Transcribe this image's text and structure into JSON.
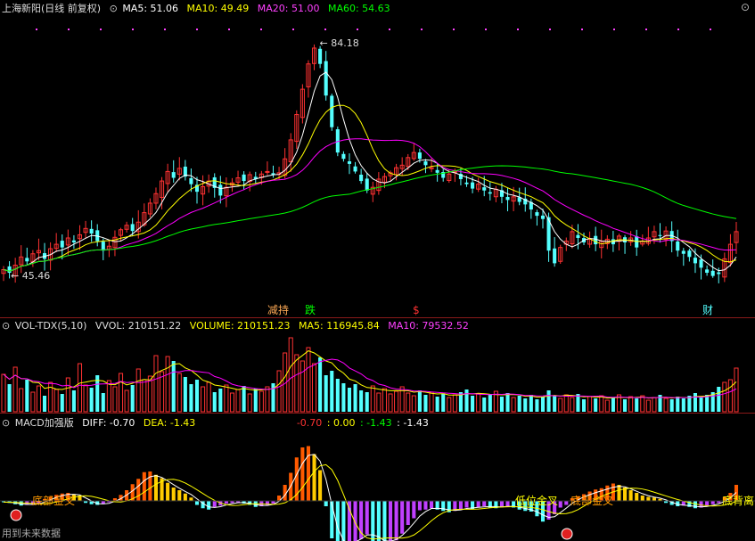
{
  "header": {
    "title": "上海新阳(日线 前复权)",
    "ma5": "MA5: 51.06",
    "ma10": "MA10: 49.49",
    "ma20": "MA20: 51.00",
    "ma60": "MA60: 54.63",
    "corner_icon": "expand-icon"
  },
  "volume_header": {
    "name": "VOL-TDX(5,10)",
    "vvol": "VVOL: 210151.22",
    "volume": "VOLUME: 210151.23",
    "ma5": "MA5: 116945.84",
    "ma10": "MA10: 79532.52"
  },
  "macd_header": {
    "name": "MACD加强版",
    "diff": "DIFF: -0.70",
    "dea": "DEA: -1.43",
    "r1": "-0.70",
    "r2": ": 0.00",
    "r3": ": -1.43",
    "r4": ": -1.43"
  },
  "footer": "用到未来数据",
  "colors": {
    "bg": "#000000",
    "up": "#ff3232",
    "down": "#54ffff",
    "ma5": "#ffffff",
    "ma10": "#ffff00",
    "ma20": "#ff00ff",
    "ma60": "#00ff00",
    "hist_up": "#ff5a00",
    "hist_up2": "#ffcc00",
    "hist_dn": "#54ffff",
    "hist_dn2": "#c040ff"
  },
  "chart_data": {
    "type": "candlestick",
    "price_range": [
      42.5,
      87.0
    ],
    "high_label": "84.18",
    "low_label": "45.46",
    "markers": [
      "减持",
      "跌",
      "$",
      "财"
    ],
    "macd_annotations": [
      "底部金叉",
      "低位金叉",
      "底部金叉",
      "底背离"
    ],
    "closes": [
      47.5,
      47.0,
      48.2,
      49.5,
      48.8,
      50.0,
      50.5,
      49.2,
      50.8,
      51.5,
      51.0,
      52.5,
      51.8,
      53.0,
      54.0,
      53.2,
      52.0,
      50.5,
      51.2,
      52.6,
      53.8,
      54.5,
      53.6,
      55.0,
      56.5,
      58.0,
      59.5,
      61.5,
      63.0,
      62.0,
      63.5,
      62.2,
      61.0,
      59.8,
      60.6,
      61.5,
      60.4,
      59.2,
      60.5,
      61.2,
      62.0,
      61.5,
      62.5,
      61.8,
      62.6,
      63.0,
      62.5,
      62.8,
      65.0,
      68.0,
      72.0,
      76.0,
      80.0,
      82.5,
      80.0,
      75.0,
      70.0,
      66.0,
      65.0,
      64.2,
      63.0,
      61.5,
      60.0,
      60.5,
      61.8,
      62.2,
      62.8,
      63.6,
      64.0,
      65.2,
      66.0,
      65.0,
      64.0,
      63.6,
      62.8,
      62.0,
      62.6,
      63.0,
      61.8,
      61.0,
      60.3,
      61.0,
      60.0,
      59.5,
      60.2,
      59.0,
      58.5,
      59.0,
      58.2,
      57.8,
      57.0,
      56.0,
      55.5,
      50.5,
      48.5,
      51.0,
      52.0,
      53.5,
      52.5,
      51.8,
      52.3,
      51.5,
      52.0,
      52.3,
      51.5,
      52.8,
      51.8,
      52.5,
      51.0,
      52.0,
      52.5,
      53.5,
      52.8,
      53.6,
      52.0,
      50.5,
      50.0,
      49.5,
      48.5,
      47.8,
      47.0,
      46.5,
      46.8,
      49.2,
      51.5,
      53.5
    ],
    "volumes": [
      4.2,
      3.1,
      5.0,
      2.6,
      3.6,
      2.2,
      2.9,
      1.8,
      3.3,
      2.5,
      2.0,
      3.8,
      2.4,
      5.4,
      3.0,
      2.7,
      4.1,
      2.1,
      3.5,
      2.8,
      4.3,
      2.4,
      3.0,
      4.8,
      3.6,
      4.0,
      6.3,
      4.5,
      6.2,
      5.7,
      4.3,
      3.9,
      3.1,
      3.6,
      2.8,
      3.3,
      2.2,
      2.6,
      3.0,
      2.1,
      2.5,
      2.9,
      2.0,
      2.6,
      2.3,
      2.8,
      3.2,
      4.6,
      6.6,
      8.3,
      6.4,
      5.7,
      7.2,
      5.4,
      6.1,
      4.1,
      4.6,
      3.7,
      3.2,
      2.7,
      3.1,
      2.4,
      2.2,
      2.9,
      2.1,
      2.6,
      2.0,
      2.3,
      2.8,
      2.1,
      1.8,
      2.4,
      1.9,
      2.2,
      1.7,
      2.0,
      1.6,
      1.9,
      2.2,
      2.5,
      1.8,
      2.0,
      1.6,
      1.9,
      2.3,
      1.7,
      2.1,
      1.6,
      1.8,
      1.5,
      1.9,
      1.4,
      1.7,
      2.4,
      1.8,
      1.5,
      1.9,
      1.6,
      2.0,
      1.4,
      1.7,
      1.5,
      1.8,
      1.3,
      1.6,
      1.9,
      1.4,
      1.7,
      1.5,
      1.8,
      1.3,
      1.6,
      1.9,
      1.5,
      1.4,
      1.7,
      1.5,
      1.8,
      2.1,
      1.6,
      1.9,
      2.2,
      2.8,
      3.3,
      3.6,
      4.9
    ],
    "macd_hist": [
      -0.2,
      -0.3,
      -0.5,
      -0.7,
      -0.6,
      -0.5,
      -0.4,
      0.3,
      0.6,
      0.9,
      1.1,
      1.2,
      1.0,
      0.8,
      -0.3,
      -0.5,
      -0.6,
      -0.4,
      -0.2,
      0.4,
      0.9,
      1.6,
      2.5,
      3.3,
      4.3,
      4.4,
      3.9,
      3.4,
      2.7,
      2.0,
      1.6,
      1.1,
      0.5,
      -0.6,
      -1.1,
      -1.3,
      -0.9,
      -0.7,
      -0.4,
      -0.3,
      -0.2,
      -0.4,
      -0.6,
      -0.9,
      -0.8,
      -0.6,
      -0.4,
      0.8,
      2.4,
      4.2,
      6.5,
      8.0,
      8.2,
      7.0,
      4.6,
      -0.8,
      -5.6,
      -7.0,
      -7.2,
      -7.0,
      -6.3,
      -5.7,
      -5.0,
      -6.2,
      -6.7,
      -7.0,
      -6.4,
      -5.9,
      -4.9,
      -3.6,
      -2.6,
      -1.4,
      -1.3,
      -1.1,
      -1.3,
      -1.5,
      -1.7,
      -1.5,
      -1.3,
      -1.0,
      -1.2,
      -1.0,
      -0.8,
      -1.0,
      -1.1,
      -0.9,
      -0.8,
      -1.0,
      -1.3,
      -1.5,
      -1.6,
      -2.3,
      -3.1,
      -2.8,
      -2.0,
      -1.0,
      -0.6,
      0.4,
      0.7,
      1.0,
      1.4,
      1.7,
      1.9,
      2.3,
      2.6,
      2.4,
      2.0,
      1.6,
      1.2,
      0.8,
      0.6,
      0.5,
      0.3,
      -0.3,
      -0.6,
      -0.8,
      -0.7,
      -0.9,
      -1.1,
      -1.0,
      -0.7,
      -0.5,
      -0.3,
      0.6,
      1.2,
      2.4
    ]
  }
}
